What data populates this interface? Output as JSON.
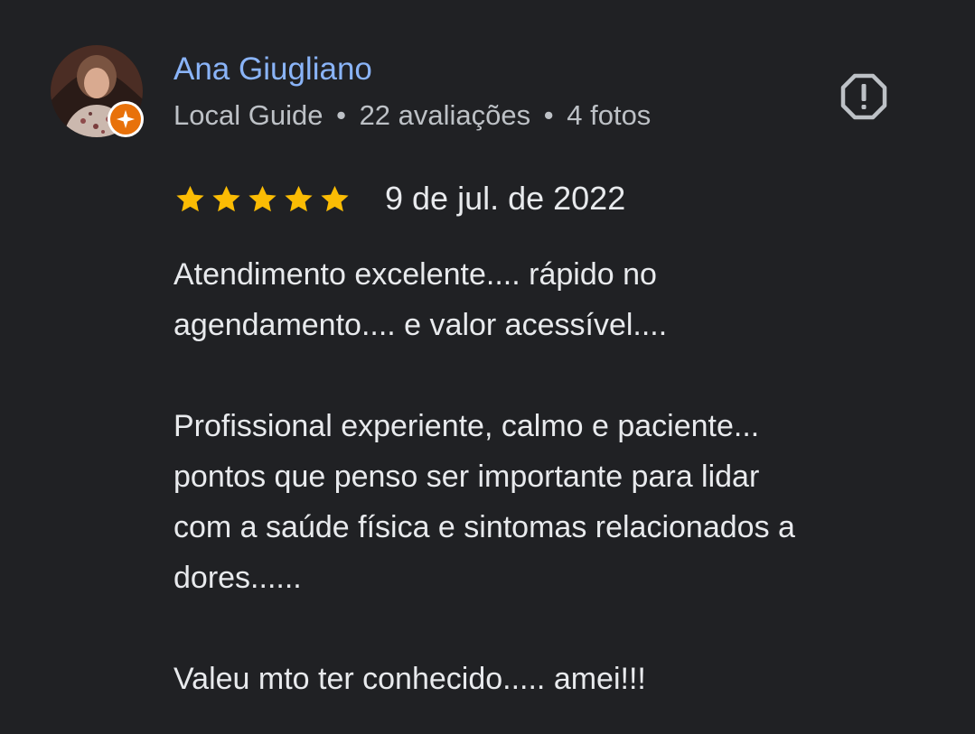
{
  "review": {
    "author": {
      "name": "Ana Giugliano",
      "badge": "Local Guide",
      "separator": "•",
      "reviews_count": "22 avaliações",
      "photos_count": "4 fotos"
    },
    "rating": {
      "stars": 5,
      "max": 5,
      "color": "#fbbc04"
    },
    "date": "9 de jul. de 2022",
    "paragraphs": [
      {
        "lines": [
          "Atendimento excelente.... rápido no",
          "agendamento.... e valor acessível...."
        ]
      },
      {
        "lines": [
          "Profissional experiente, calmo e paciente...",
          "pontos que penso ser importante para lidar",
          "com a saúde física e sintomas relacionados a",
          "dores......"
        ]
      },
      {
        "lines": [
          "Valeu mto ter conhecido..... amei!!!"
        ]
      }
    ],
    "icons": {
      "report": "report-octagon-icon",
      "local_guide": "local-guide-star-icon"
    },
    "colors": {
      "background": "#202124",
      "name": "#8ab4f8",
      "meta": "#bdc1c6",
      "text": "#e8eaed",
      "local_guide_badge": "#e8710a"
    }
  }
}
